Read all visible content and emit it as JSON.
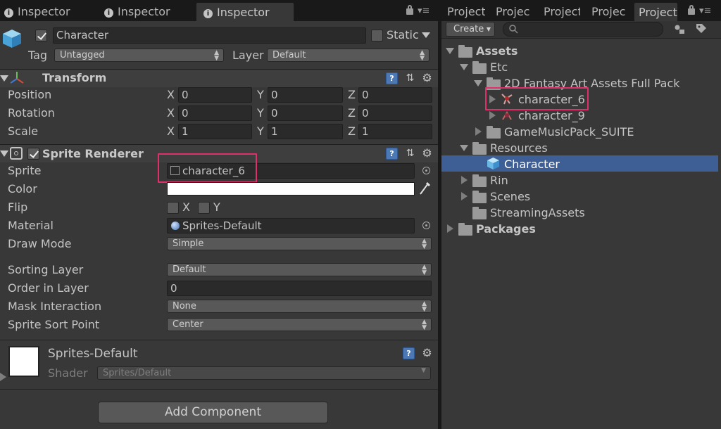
{
  "inspector_tabs": [
    {
      "label": "Inspector",
      "active": false
    },
    {
      "label": "Inspector",
      "active": false
    },
    {
      "label": "Inspector",
      "active": true
    }
  ],
  "project_tabs": [
    {
      "label": "Project",
      "active": false
    },
    {
      "label": "Projec",
      "active": false
    },
    {
      "label": "Project",
      "active": false
    },
    {
      "label": "Projec",
      "active": false
    },
    {
      "label": "Project",
      "active": true
    }
  ],
  "object": {
    "name": "Character",
    "static_label": "Static",
    "tag_label": "Tag",
    "tag_value": "Untagged",
    "layer_label": "Layer",
    "layer_value": "Default"
  },
  "transform": {
    "title": "Transform",
    "rows": [
      {
        "label": "Position",
        "x": "0",
        "y": "0",
        "z": "0"
      },
      {
        "label": "Rotation",
        "x": "0",
        "y": "0",
        "z": "0"
      },
      {
        "label": "Scale",
        "x": "1",
        "y": "1",
        "z": "1"
      }
    ],
    "axes": [
      "X",
      "Y",
      "Z"
    ]
  },
  "sprite_renderer": {
    "title": "Sprite Renderer",
    "sprite_label": "Sprite",
    "sprite_value": "character_6",
    "color_label": "Color",
    "color_value": "#ffffff",
    "flip_label": "Flip",
    "flip_x": "X",
    "flip_y": "Y",
    "material_label": "Material",
    "material_value": "Sprites-Default",
    "draw_mode_label": "Draw Mode",
    "draw_mode_value": "Simple",
    "sorting_layer_label": "Sorting Layer",
    "sorting_layer_value": "Default",
    "order_label": "Order in Layer",
    "order_value": "0",
    "mask_label": "Mask Interaction",
    "mask_value": "None",
    "sort_point_label": "Sprite Sort Point",
    "sort_point_value": "Center"
  },
  "material": {
    "name": "Sprites-Default",
    "shader_label": "Shader",
    "shader_value": "Sprites/Default"
  },
  "add_component_label": "Add Component",
  "project": {
    "create_label": "Create",
    "search_placeholder": "",
    "tree": {
      "assets": "Assets",
      "etc": "Etc",
      "fantasy_pack": "2D Fantasy Art Assets Full Pack",
      "character_6": "character_6",
      "character_9": "character_9",
      "music_pack": "GameMusicPack_SUITE",
      "resources": "Resources",
      "character": "Character",
      "rin": "Rin",
      "scenes": "Scenes",
      "streaming": "StreamingAssets",
      "packages": "Packages"
    }
  },
  "colors": {
    "selection": "#3e5f96",
    "highlight_box": "#e0306a",
    "help_icon": "#4c78b4"
  }
}
